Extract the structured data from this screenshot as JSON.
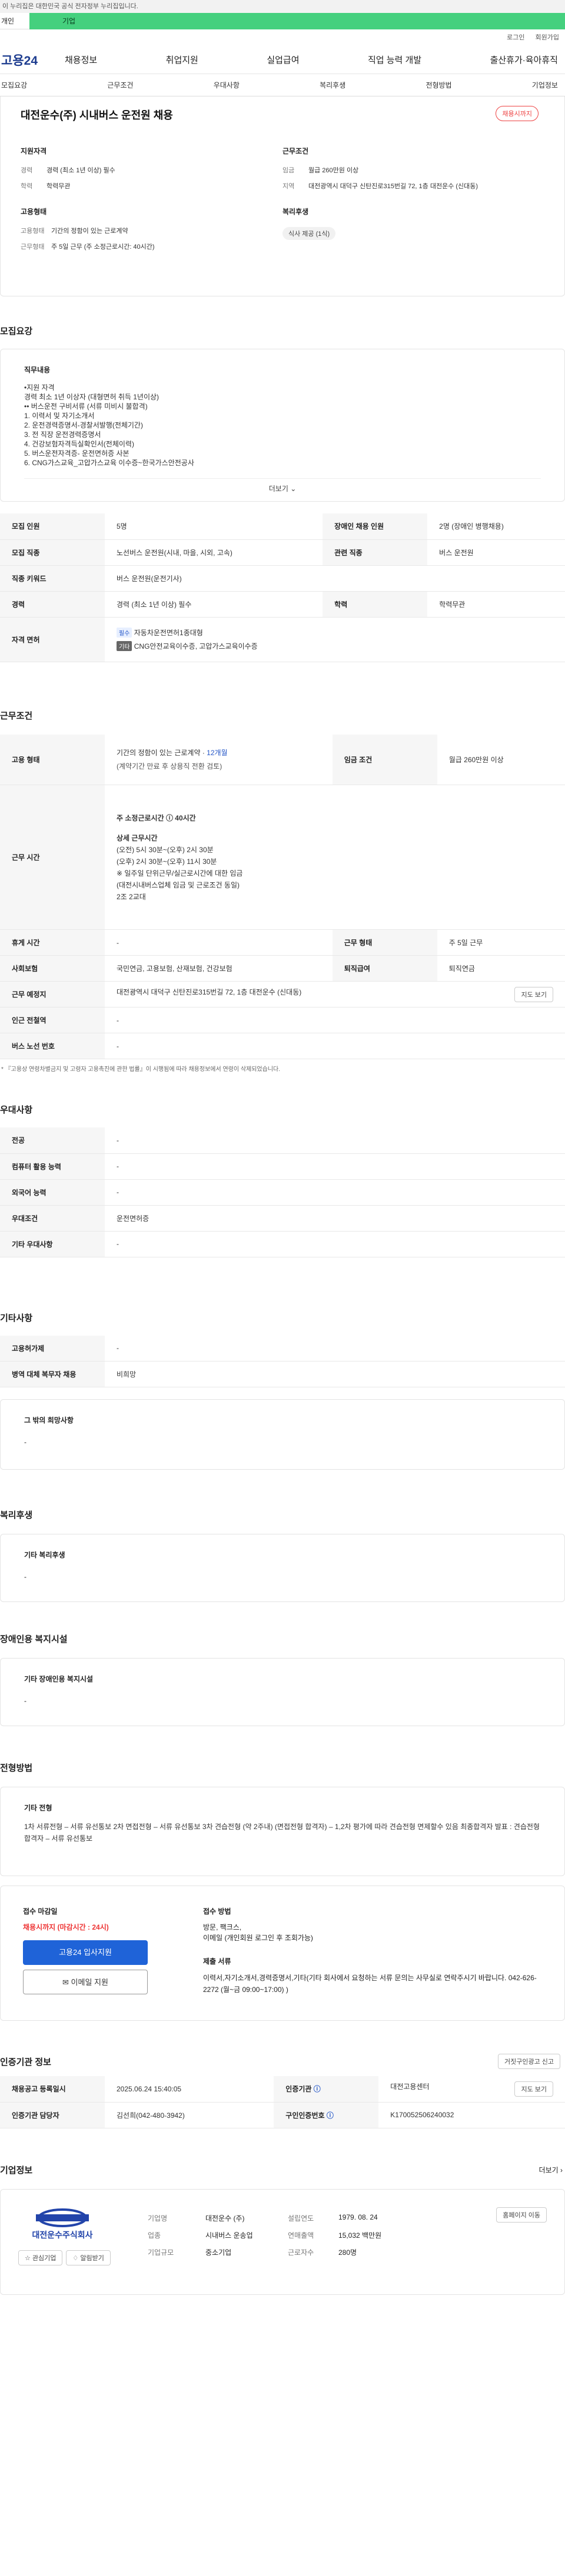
{
  "top": {
    "notice": "이 누리집은 대한민국 공식 전자정부 누리집입니다.",
    "tab1": "개인",
    "tab2": "기업",
    "login": "로그인",
    "join": "회원가입"
  },
  "gnb": {
    "logo": "고용24",
    "menu": [
      "채용정보",
      "취업지원",
      "실업급여",
      "직업 능력 개발",
      "출산휴가·육아휴직"
    ]
  },
  "anchors": [
    "모집요강",
    "근무조건",
    "우대사항",
    "복리후생",
    "전형방법",
    "기업정보"
  ],
  "summary": {
    "title": "대전운수(주) 시내버스 운전원 채용",
    "badge": "채용시까지",
    "qual_h": "지원자격",
    "cond_h": "근무조건",
    "q": [
      {
        "k": "경력",
        "v": "경력 (최소 1년 이상) 필수"
      },
      {
        "k": "학력",
        "v": "학력무관"
      }
    ],
    "c": [
      {
        "k": "임금",
        "v": "월급 260만원 이상"
      },
      {
        "k": "지역",
        "v": "대전광역시 대덕구 신탄진로315번길 72, 1층 대전운수 (신대동)"
      }
    ],
    "type_h": "고용형태",
    "welfare_h": "복리후생",
    "t": [
      {
        "k": "고용형태",
        "v": "기간의 정함이 있는 근로계약"
      },
      {
        "k": "근무형태",
        "v": "주 5일 근무 (주 소정근로시간: 40시간)"
      }
    ],
    "welfare_chip": "식사 제공 (1식)"
  },
  "recruit": {
    "title": "모집요강",
    "job_h": "직무내용",
    "lines": [
      "•지원 자격",
      "경력 최소 1년 이상자 (대형면허 취득 1년이상)",
      "•• 버스운전 구비서류 (서류 미비시 불합격)",
      "1. 이력서 및 자기소개서",
      "2. 운전경력증명서-경찰서발행(전체기간)",
      "3. 전 직장 운전경력증명서",
      "4. 건강보험자격득실확인서(전체이력)",
      "5. 버스운전자격증- 운전면허증 사본",
      "6. CNG가스교육_고압가스교육 이수증~한국가스안전공사"
    ],
    "more": "더보기",
    "rows": [
      {
        "k1": "모집 인원",
        "v1": "5명",
        "k2": "장애인 채용 인원",
        "v2": "2명 (장애인 병행채용)"
      },
      {
        "k1": "모집 직종",
        "v1": "노선버스 운전원(시내, 마을, 시외, 고속)",
        "k2": "관련 직종",
        "v2": "버스 운전원"
      },
      {
        "k1": "직종 키워드",
        "v1": "버스 운전원(운전기사)"
      },
      {
        "k1": "경력",
        "v1": "경력 (최소 1년 이상) 필수",
        "k2": "학력",
        "v2": "학력무관"
      }
    ],
    "license_h": "자격 면허",
    "lic1_tag": "필수",
    "lic1": "자동차운전면허1종대형",
    "lic2_tag": "기타",
    "lic2": "CNG안전교육이수증, 고압가스교육이수증"
  },
  "work": {
    "title": "근무조건",
    "emp_h": "고용 형태",
    "emp_v": "기간의 정함이 있는 근로계약 · ",
    "emp_v2": "12개월",
    "emp_sub": "(계약기간 만료 후 상용직 전환 검토)",
    "wage_h": "임금 조건",
    "wage_v": "월급 260만원 이상",
    "time_h": "근무 시간",
    "time_lines": [
      "주 소정근로시간 ⓘ 40시간",
      "상세 근무시간",
      "(오전) 5시 30분~(오후)  2시 30분",
      "(오후) 2시 30분~(오후) 11시 30분",
      "※ 일주일 단위근무/실근로시간에 대한 임금",
      "(대전시내버스업체 임금 및 근로조건 동일)",
      "2조 2교대"
    ],
    "rest_h": "휴게 시간",
    "rest_v": "-",
    "form_h": "근무 형태",
    "form_v": "주 5일 근무",
    "ins_h": "사회보험",
    "ins_v": "국민연금, 고용보험, 산재보험, 건강보험",
    "ret_h": "퇴직급여",
    "ret_v": "퇴직연금",
    "place_h": "근무 예정지",
    "place_v": "대전광역시 대덕구 신탄진로315번길 72, 1층 대전운수 (신대동)",
    "map": "지도 보기",
    "sub_h": "인근 전철역",
    "sub_v": "-",
    "bus_h": "버스 노선 번호",
    "bus_v": "-",
    "note": "* 『고용상 연령차별금지 및 고령자 고용촉진에 관한 법률』이 시행됨에 따라 채용정보에서 연령이 삭제되었습니다."
  },
  "pref": {
    "title": "우대사항",
    "rows": [
      {
        "k": "전공",
        "v": "-"
      },
      {
        "k": "컴퓨터 활용 능력",
        "v": "-"
      },
      {
        "k": "외국어 능력",
        "v": "-"
      },
      {
        "k": "우대조건",
        "v": "운전면허증"
      },
      {
        "k": "기타 우대사항",
        "v": "-"
      }
    ]
  },
  "etc": {
    "title": "기타사항",
    "rows": [
      {
        "k": "고용허가제",
        "v": "-"
      },
      {
        "k": "병역 대체 복무자 채용",
        "v": "비희망"
      }
    ],
    "other_h": "그 밖의 희망사항",
    "other_v": "-"
  },
  "welfare": {
    "title": "복리후생",
    "h": "기타 복리후생",
    "v": "-"
  },
  "disab": {
    "title": "장애인용 복지시설",
    "h": "기타 장애인용 복지시설",
    "v": "-"
  },
  "process": {
    "title": "전형방법",
    "h": "기타 전형",
    "v": "1차 서류전형 – 서류 유선통보 2차 면접전형 – 서류 유선통보 3차 견습전형 (약 2주내) (면접전형 합격자) – 1,2차 평가에 따라 견습전형 면제할수 있음 최종합격자 발표 : 견습전형 합격자 – 서류 유선통보",
    "deadline_h": "접수 마감일",
    "deadline_v": "채용시까지 (마감시간 : 24시)",
    "apply_btn": "고용24 입사지원",
    "mail_btn": "이메일 지원",
    "method_h": "접수 방법",
    "method_v1": "방문, 팩크스,",
    "method_v2": "이메일 (개인회원 로그인 후 조회가능)",
    "docs_h": "제출 서류",
    "docs_v": "이력서,자기소개서,경력증명서,기타(기타 회사에서 요청하는 서류 문의는 사무실로 연락주시기 바랍니다. 042-626-2272 (월~금 09:00~17:00) )"
  },
  "auth": {
    "title": "인증기관 정보",
    "report": "거짓구인광고 신고",
    "rows": [
      {
        "k1": "채용공고 등록일시",
        "v1": "2025.06.24 15:40:05",
        "k2": "인증기관",
        "v2": "대전고용센터",
        "map": "지도 보기"
      },
      {
        "k1": "인증기관 담당자",
        "v1": "김선희(042-480-3942)",
        "k2": "구인인증번호",
        "v2": "K170052506240032"
      }
    ]
  },
  "comp": {
    "title": "기업정보",
    "more": "더보기",
    "logo_text": "대전운수주식회사",
    "fav": "관심기업",
    "alert": "알림받기",
    "info": [
      [
        "기업명",
        "대전운수 (주)",
        "설립연도",
        "1979. 08. 24"
      ],
      [
        "업종",
        "시내버스 운송업",
        "연매출액",
        "15,032 백만원"
      ],
      [
        "기업규모",
        "중소기업",
        "근로자수",
        "280명"
      ]
    ],
    "hp": "홈페이지 이동"
  }
}
